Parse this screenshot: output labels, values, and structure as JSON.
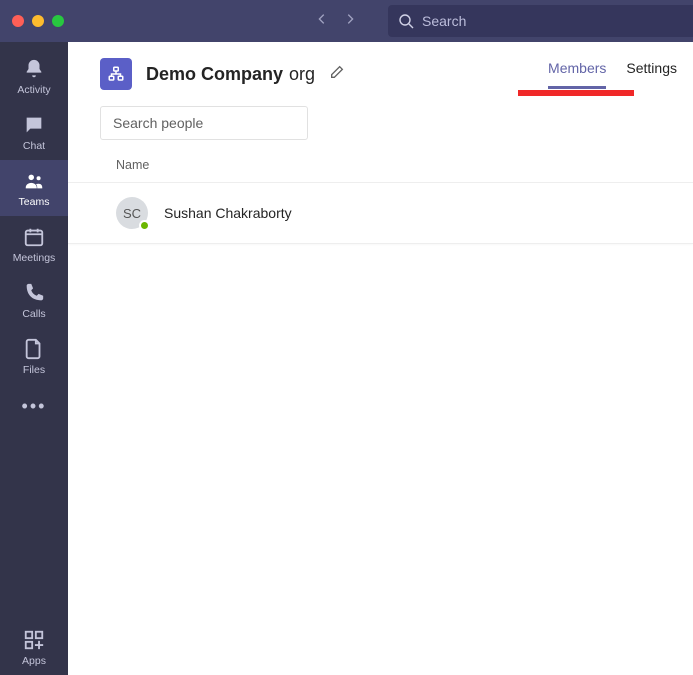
{
  "titlebar": {
    "search_placeholder": "Search"
  },
  "rail": {
    "items": [
      {
        "label": "Activity"
      },
      {
        "label": "Chat"
      },
      {
        "label": "Teams"
      },
      {
        "label": "Meetings"
      },
      {
        "label": "Calls"
      },
      {
        "label": "Files"
      }
    ],
    "apps_label": "Apps"
  },
  "header": {
    "team_name_bold": "Demo Company",
    "team_name_suffix": "org"
  },
  "tabs": {
    "members": "Members",
    "settings": "Settings"
  },
  "search_people": {
    "placeholder": "Search people"
  },
  "list": {
    "column_name": "Name",
    "members": [
      {
        "initials": "SC",
        "name": "Sushan Chakraborty"
      }
    ]
  }
}
